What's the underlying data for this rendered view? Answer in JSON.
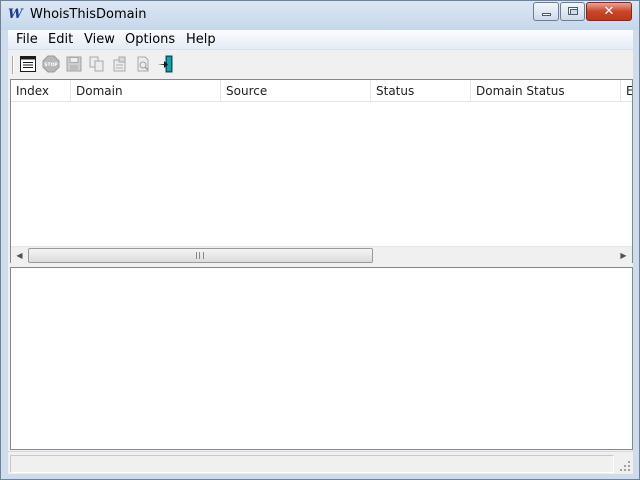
{
  "window": {
    "title": "WhoisThisDomain",
    "app_icon_glyph": "W",
    "app_icon_name": "whois-app-icon",
    "close_glyph": "✕"
  },
  "menu": {
    "items": [
      "File",
      "Edit",
      "View",
      "Options",
      "Help"
    ]
  },
  "toolbar": {
    "buttons": [
      {
        "name": "domain-list-icon",
        "enabled": true
      },
      {
        "name": "stop-icon",
        "enabled": false
      },
      {
        "name": "save-icon",
        "enabled": false
      },
      {
        "name": "copy-icon",
        "enabled": false
      },
      {
        "name": "properties-icon",
        "enabled": false
      },
      {
        "name": "refresh-icon",
        "enabled": false
      },
      {
        "name": "exit-icon",
        "enabled": true
      }
    ]
  },
  "list": {
    "columns": [
      "Index",
      "Domain",
      "Source",
      "Status",
      "Domain Status",
      "E"
    ],
    "rows": []
  },
  "scrollbar": {
    "left_arrow": "◀",
    "right_arrow": "▶"
  },
  "colors": {
    "title_bar": "#cfdcec",
    "close_button": "#c9452a",
    "exit_icon": "#17a2a8"
  }
}
